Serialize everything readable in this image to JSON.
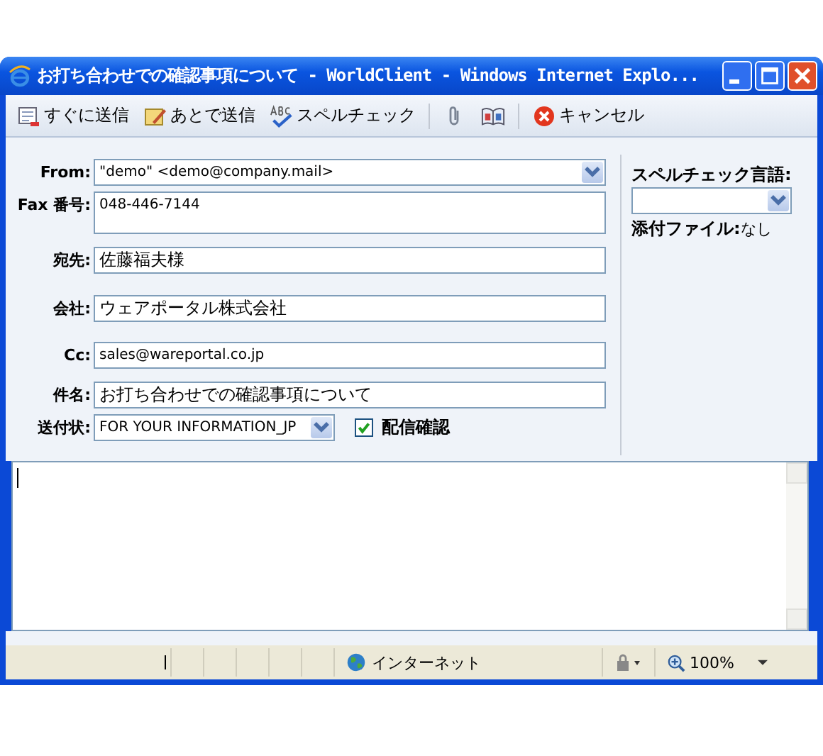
{
  "window": {
    "title": "お打ち合わせでの確認事項について - WorldClient - Windows Internet Explo..."
  },
  "toolbar": [
    {
      "kind": "send",
      "label": "すぐに送信"
    },
    {
      "kind": "later",
      "label": "あとで送信"
    },
    {
      "kind": "spell",
      "label": "スペルチェック"
    },
    {
      "kind": "separator"
    },
    {
      "kind": "attach"
    },
    {
      "kind": "book"
    },
    {
      "kind": "separator"
    },
    {
      "kind": "cancel",
      "label": "キャンセル"
    }
  ],
  "fields": [
    {
      "kind": "select",
      "label": "From:",
      "value": "\"demo\" <demo@company.mail>"
    },
    {
      "kind": "multiline",
      "label": "Fax 番号:",
      "value": "048-446-7144"
    },
    {
      "kind": "text",
      "label": "宛先:",
      "value": "佐藤福夫様"
    },
    {
      "kind": "text",
      "label": "会社:",
      "value": "ウェアポータル株式会社"
    },
    {
      "kind": "text",
      "label": "Cc:",
      "value": "sales@wareportal.co.jp"
    },
    {
      "kind": "text",
      "label": "件名:",
      "value": "お打ち合わせでの確認事項について"
    }
  ],
  "cover": {
    "label": "送付状:",
    "value": "FOR YOUR INFORMATION_JP"
  },
  "delivery_receipt": {
    "label": "配信確認",
    "checked": true
  },
  "side": {
    "spell_language_label": "スペルチェック言語:",
    "attachments_label": "添付ファイル:",
    "attachments_value": "なし"
  },
  "status_bar": {
    "zone": "インターネット",
    "zoom": "100%"
  }
}
